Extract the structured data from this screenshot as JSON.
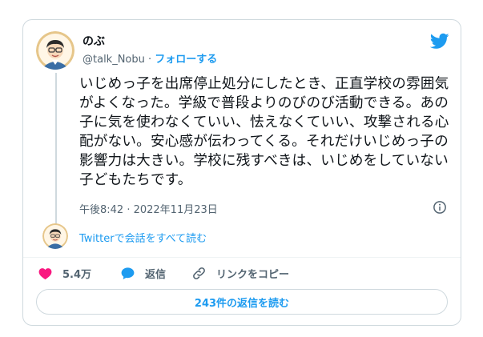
{
  "author": {
    "name": "のぶ",
    "handle": "@talk_Nobu",
    "separator": " · ",
    "follow_label": "フォローする"
  },
  "tweet": {
    "text": "いじめっ子を出席停止処分にしたとき、正直学校の雰囲気がよくなった。学級で普段よりのびのび活動できる。あの子に気を使わなくていい、怯えなくていい、攻撃される心配がない。安心感が伝わってくる。それだけいじめっ子の影響力は大きい。学校に残すべきは、いじめをしていない子どもたちです。",
    "timestamp": "午後8:42 · 2022年11月23日"
  },
  "thread": {
    "link_label": "Twitterで会話をすべて読む"
  },
  "actions": {
    "like_count": "5.4万",
    "reply_label": "返信",
    "copy_link_label": "リンクをコピー"
  },
  "replies_button": {
    "label": "243件の返信を読む"
  },
  "icons": {
    "brand": "twitter-bird-icon",
    "info": "info-icon",
    "like": "heart-icon",
    "reply": "reply-bubble-icon",
    "link": "link-icon"
  },
  "colors": {
    "accent": "#1d9bf0",
    "like": "#f91880",
    "text": "#0f1419",
    "muted": "#536471",
    "border": "#cfd9de"
  }
}
